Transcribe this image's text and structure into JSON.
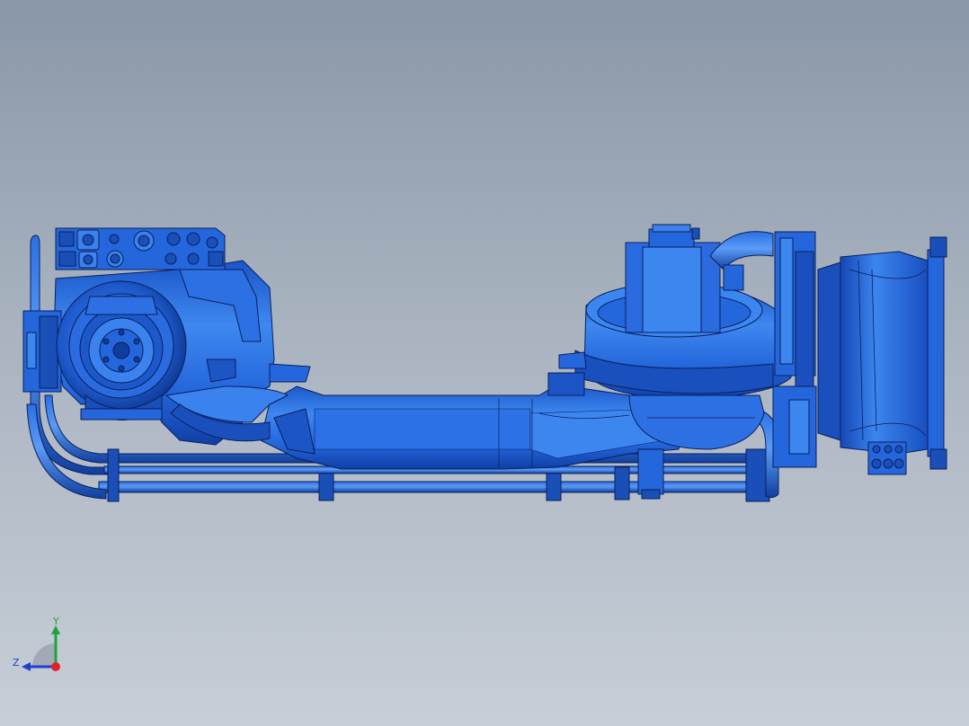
{
  "viewport": {
    "background_top": "#8a97a8",
    "background_bottom": "#c7ced7",
    "model_color": "#1f5fd8",
    "model_highlight": "#3d86f2",
    "model_shadow": "#0c3a9e",
    "edge_color": "#0a1f5c"
  },
  "triad": {
    "y_axis_label": "Y",
    "z_axis_label": "Z",
    "y_axis_color": "#1fa33a",
    "z_axis_color": "#1e3fd0",
    "x_axis_color": "#e0202a"
  }
}
